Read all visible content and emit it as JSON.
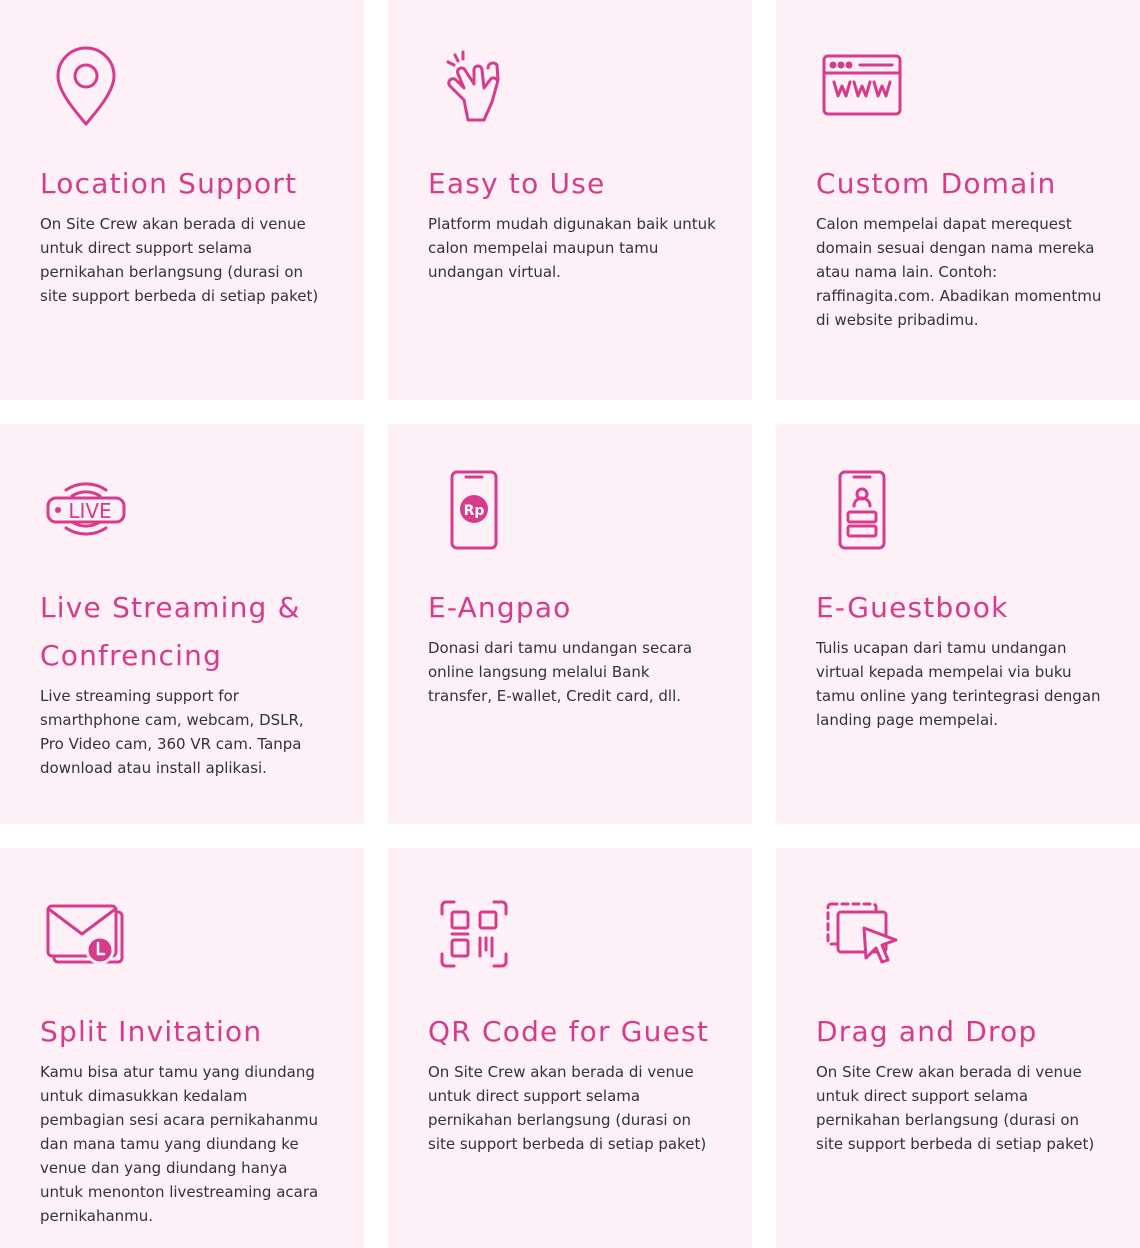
{
  "colors": {
    "card_bg": "#fdf0f6",
    "accent": "#d63b8c",
    "text": "#3a3036"
  },
  "features": [
    {
      "icon": "location-pin-icon",
      "title": "Location Support",
      "description": "On Site Crew akan berada di venue untuk direct support selama pernikahan berlangsung (durasi on site support berbeda di setiap paket)"
    },
    {
      "icon": "hand-tap-icon",
      "title": "Easy to Use",
      "description": "Platform mudah digunakan baik untuk calon mempelai maupun tamu undangan virtual."
    },
    {
      "icon": "browser-www-icon",
      "title": "Custom Domain",
      "description": "Calon mempelai dapat merequest domain sesuai dengan nama mereka atau nama lain. Contoh: raffinagita.com. Abadikan momentmu di website pribadimu."
    },
    {
      "icon": "live-stream-icon",
      "title": "Live Streaming & Confrencing",
      "description": "Live streaming support for smarthphone cam, webcam, DSLR, Pro Video cam, 360 VR cam. Tanpa download atau install aplikasi.",
      "icon_text": "LIVE"
    },
    {
      "icon": "phone-rupiah-icon",
      "title": "E-Angpao",
      "description": "Donasi dari tamu undangan secara online langsung melalui Bank transfer, E-wallet, Credit card, dll.",
      "icon_text": "Rp"
    },
    {
      "icon": "phone-guestbook-icon",
      "title": "E-Guestbook",
      "description": "Tulis ucapan dari tamu undangan virtual kepada mempelai via buku tamu online yang terintegrasi dengan landing page mempelai."
    },
    {
      "icon": "mail-clock-icon",
      "title": "Split Invitation",
      "description": "Kamu bisa atur tamu yang diundang untuk dimasukkan kedalam pembagian sesi acara pernikahanmu dan mana tamu yang diundang ke venue dan yang diundang hanya untuk menonton livestreaming acara pernikahanmu."
    },
    {
      "icon": "qr-code-icon",
      "title": "QR Code for Guest",
      "description": "On Site Crew akan berada di venue untuk direct support selama pernikahan berlangsung (durasi on site support berbeda di setiap paket)"
    },
    {
      "icon": "drag-drop-cursor-icon",
      "title": "Drag and Drop",
      "description": "On Site Crew akan berada di venue untuk direct support selama pernikahan berlangsung (durasi on site support berbeda di setiap paket)"
    }
  ]
}
